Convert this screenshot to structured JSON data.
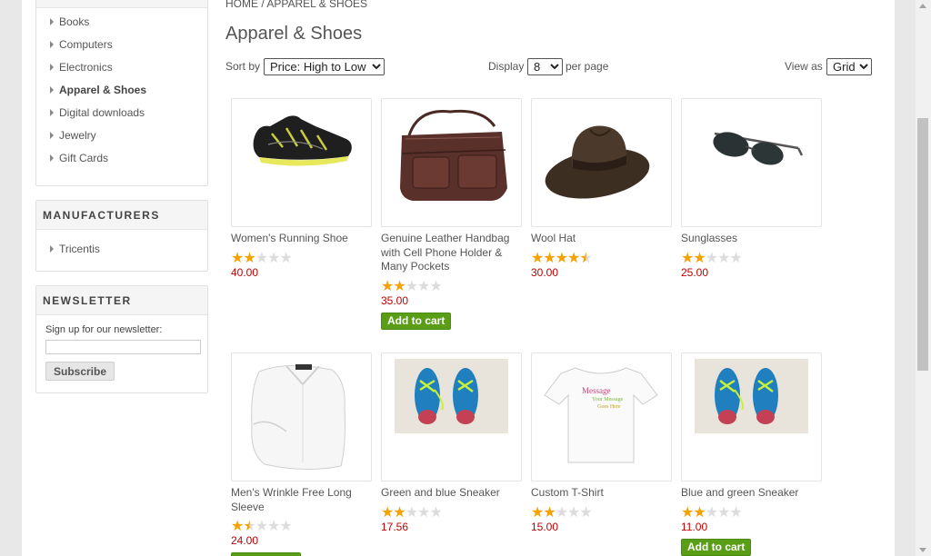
{
  "breadcrumb": {
    "home": "Home",
    "separator": " / ",
    "current": "Apparel & Shoes"
  },
  "page_title": "Apparel & Shoes",
  "categories": {
    "items": [
      {
        "label": "Books"
      },
      {
        "label": "Computers"
      },
      {
        "label": "Electronics"
      },
      {
        "label": "Apparel & Shoes",
        "active": true
      },
      {
        "label": "Digital downloads"
      },
      {
        "label": "Jewelry"
      },
      {
        "label": "Gift Cards"
      }
    ]
  },
  "manufacturers": {
    "title": "MANUFACTURERS",
    "items": [
      {
        "label": "Tricentis"
      }
    ]
  },
  "newsletter": {
    "title": "NEWSLETTER",
    "prompt": "Sign up for our newsletter:",
    "input_value": "",
    "button": "Subscribe"
  },
  "toolbar": {
    "sort_label": "Sort by",
    "sort_value": "Price: High to Low",
    "display_label": "Display",
    "display_value": "8",
    "per_page": "per page",
    "view_label": "View as",
    "view_value": "Grid"
  },
  "products": [
    {
      "title": "Women's Running Shoe",
      "rating": 2,
      "price": "40.00",
      "image": "running-shoe-image",
      "cart": false
    },
    {
      "title": "Genuine Leather Handbag with Cell Phone Holder & Many Pockets",
      "rating": 2,
      "price": "35.00",
      "image": "leather-handbag-image",
      "cart": true
    },
    {
      "title": "Wool Hat",
      "rating": 4.5,
      "price": "30.00",
      "image": "wool-hat-image",
      "cart": false
    },
    {
      "title": "Sunglasses",
      "rating": 2,
      "price": "25.00",
      "image": "sunglasses-image",
      "cart": false
    },
    {
      "title": "Men's Wrinkle Free Long Sleeve",
      "rating": 1.5,
      "price": "24.00",
      "image": "dress-shirt-image",
      "cart": true
    },
    {
      "title": "Green and blue Sneaker",
      "rating": 2,
      "price": "17.56",
      "image": "sneaker-image",
      "cart": false
    },
    {
      "title": "Custom T-Shirt",
      "rating": 2,
      "price": "15.00",
      "image": "custom-tshirt-image",
      "cart": false,
      "shirt_text": [
        "Message",
        "Your Message",
        "Goes Here"
      ]
    },
    {
      "title": "Blue and green Sneaker",
      "rating": 2,
      "price": "11.00",
      "image": "sneaker-image",
      "cart": true
    }
  ],
  "add_to_cart_label": "Add to cart",
  "colors": {
    "accent_green": "#5a9e17",
    "price_red": "#c00000",
    "star_gold": "#f5a200"
  }
}
